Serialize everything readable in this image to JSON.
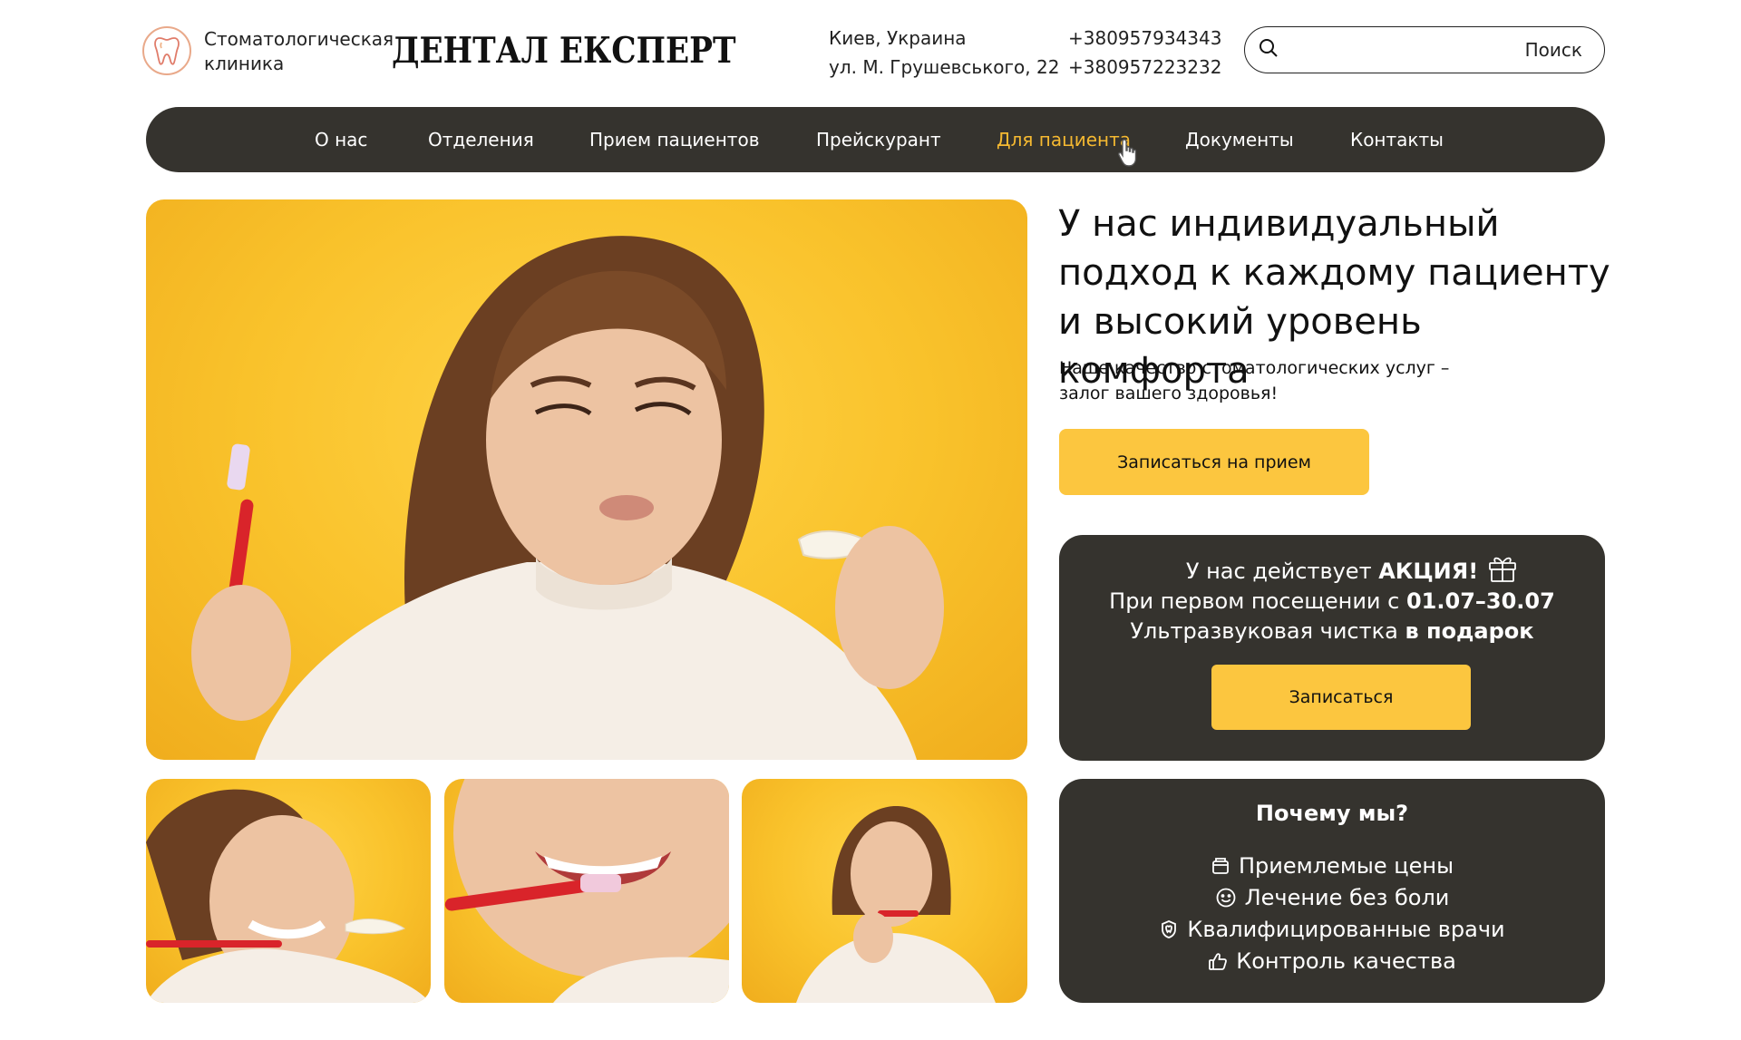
{
  "header": {
    "logo_subtitle_line1": "Стоматологическая",
    "logo_subtitle_line2": "клиника",
    "brand": "ДЕНТАЛ ЕКСПЕРТ",
    "address_line1": "Киев, Украина",
    "address_line2": "ул. М. Грушевського, 22",
    "phone1": "+380957934343",
    "phone2": "+380957223232",
    "search": {
      "value": "",
      "button_label": "Поиск"
    }
  },
  "nav": {
    "items": [
      {
        "label": "О нас"
      },
      {
        "label": "Отделения"
      },
      {
        "label": "Прием пациентов"
      },
      {
        "label": "Прейскурант"
      },
      {
        "label": "Для пациента",
        "active": true
      },
      {
        "label": "Документы"
      },
      {
        "label": "Контакты"
      }
    ]
  },
  "hero": {
    "title_line1": "У нас индивидуальный",
    "title_line2": "подход к каждому пациенту",
    "title_line3": "и высокий уровень комфорта",
    "subtitle_line1": "Наше качество стоматологических услуг –",
    "subtitle_line2": "залог вашего здоровья!",
    "cta_label": "Записаться на прием"
  },
  "promo": {
    "line1_text": "У нас действует ",
    "line1_bold": "АКЦИЯ!",
    "line2_text": "При первом посещении с ",
    "line2_bold": "01.07–30.07",
    "line3_text": "Ультразвуковая чистка ",
    "line3_bold": "в подарок",
    "button_label": "Записаться"
  },
  "why": {
    "title": "Почему мы?",
    "items": [
      {
        "label": "Приемлемые цены",
        "icon": "wallet-icon"
      },
      {
        "label": "Лечение без боли",
        "icon": "smile-icon"
      },
      {
        "label": "Квалифицированные врачи",
        "icon": "tooth-shield-icon"
      },
      {
        "label": "Контроль качества",
        "icon": "thumbs-up-icon"
      }
    ]
  },
  "colors": {
    "accent": "#fcc63f",
    "dark": "#35332e",
    "photo_bg": "#f9c22b",
    "nav_active": "#f5b931"
  }
}
